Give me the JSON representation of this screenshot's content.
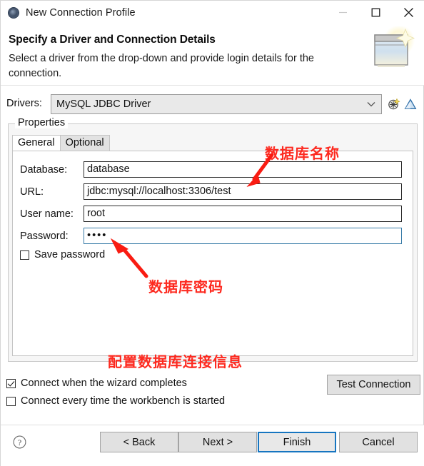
{
  "window": {
    "title": "New Connection Profile",
    "icon": "connection-profile-icon",
    "minimize": "–",
    "maximize": "□",
    "close": "✕"
  },
  "header": {
    "title": "Specify a Driver and Connection Details",
    "description": "Select a driver from the drop-down and provide login details for the connection.",
    "image": "database-wizard-icon"
  },
  "drivers": {
    "label": "Drivers:",
    "value": "MySQL JDBC Driver",
    "options": [
      "MySQL JDBC Driver"
    ],
    "new_driver_icon": "new-driver-icon",
    "edit_driver_icon": "edit-driver-icon"
  },
  "properties": {
    "legend": "Properties",
    "tabs": [
      {
        "label": "General",
        "active": true
      },
      {
        "label": "Optional",
        "active": false
      }
    ],
    "fields": [
      {
        "label": "Database:",
        "value": "database",
        "focused": false,
        "masked": false
      },
      {
        "label": "URL:",
        "value": "jdbc:mysql://localhost:3306/test",
        "focused": false,
        "masked": false
      },
      {
        "label": "User name:",
        "value": "root",
        "focused": false,
        "masked": false
      },
      {
        "label": "Password:",
        "value": "••••",
        "focused": true,
        "masked": true
      }
    ],
    "save_password": {
      "label": "Save password",
      "checked": false
    }
  },
  "options": [
    {
      "label": "Connect when the wizard completes",
      "checked": true
    },
    {
      "label": "Connect every time the workbench is started",
      "checked": false
    }
  ],
  "test_connection": {
    "label": "Test Connection"
  },
  "footer": {
    "help_icon": "help-icon",
    "buttons": [
      {
        "label": "< Back",
        "primary": false
      },
      {
        "label": "Next >",
        "primary": false
      },
      {
        "label": "Finish",
        "primary": true
      },
      {
        "label": "Cancel",
        "primary": false
      }
    ]
  },
  "annotations": [
    {
      "text": "数据库名称",
      "color": "#fd2a20"
    },
    {
      "text": "数据库密码",
      "color": "#fd2a20"
    },
    {
      "text": "配置数据库连接信息",
      "color": "#fd2a20"
    }
  ]
}
